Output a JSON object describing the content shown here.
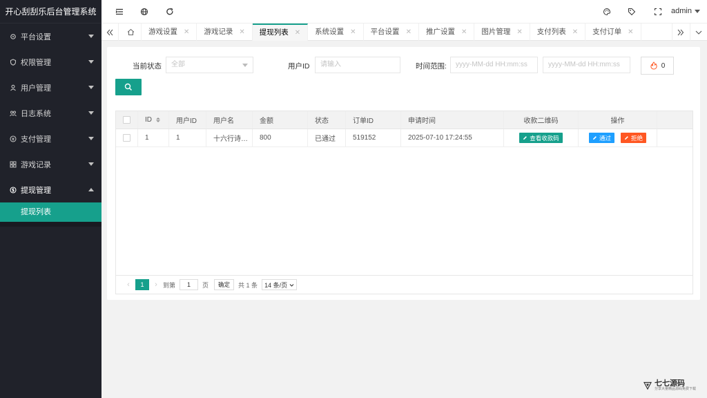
{
  "app": {
    "title": "开心刮刮乐后台管理系统"
  },
  "sidebar": {
    "items": [
      {
        "label": "平台设置",
        "icon": "gear-icon"
      },
      {
        "label": "权限管理",
        "icon": "shield-icon"
      },
      {
        "label": "用户管理",
        "icon": "user-icon"
      },
      {
        "label": "日志系统",
        "icon": "group-icon"
      },
      {
        "label": "支付管理",
        "icon": "coin-icon"
      },
      {
        "label": "游戏记录",
        "icon": "grid-icon"
      },
      {
        "label": "提现管理",
        "icon": "dollar-icon"
      }
    ],
    "sub_items": [
      {
        "label": "提现列表"
      }
    ]
  },
  "header": {
    "user": "admin"
  },
  "tabs": [
    {
      "label": "游戏设置"
    },
    {
      "label": "游戏记录"
    },
    {
      "label": "提现列表",
      "active": true
    },
    {
      "label": "系统设置"
    },
    {
      "label": "平台设置"
    },
    {
      "label": "推广设置"
    },
    {
      "label": "图片管理"
    },
    {
      "label": "支付列表"
    },
    {
      "label": "支付订单"
    }
  ],
  "filters": {
    "status_label": "当前状态",
    "status_value": "全部",
    "userid_label": "用户ID",
    "userid_placeholder": "请输入",
    "time_label": "时间范围:",
    "time_start_placeholder": "yyyy-MM-dd HH:mm:ss",
    "time_end_placeholder": "yyyy-MM-dd HH:mm:ss",
    "fire_count": "0"
  },
  "table": {
    "columns": [
      "ID",
      "用户ID",
      "用户名",
      "金额",
      "状态",
      "订单ID",
      "申请时间",
      "收款二维码",
      "操作"
    ],
    "rows": [
      {
        "id": "1",
        "user_id": "1",
        "username": "十六行诗…",
        "amount": "800",
        "status": "已通过",
        "order_id": "519152",
        "apply_time": "2025-07-10 17:24:55",
        "qr_button": "查看收款码",
        "approve_button": "通过",
        "reject_button": "拒绝"
      }
    ]
  },
  "pager": {
    "current": "1",
    "goto_label": "到第",
    "goto_value": "1",
    "page_unit": "页",
    "confirm": "确定",
    "total": "共 1 条",
    "page_size": "14 条/页"
  },
  "watermark": {
    "title": "七七源码",
    "subtitle": "分享大量精品源码免费下载"
  },
  "colors": {
    "accent": "#16a08c",
    "sidebar_bg": "#20222a",
    "blue": "#1e9fff",
    "red": "#ff5722"
  }
}
